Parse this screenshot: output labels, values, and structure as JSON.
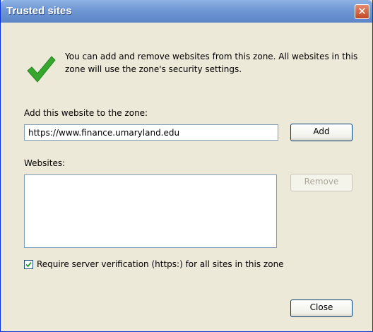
{
  "window": {
    "title": "Trusted sites",
    "close_glyph": "✕"
  },
  "info": {
    "icon": "checkmark-icon",
    "text": "You can add and remove websites from this zone. All websites in this zone will use the zone's security settings."
  },
  "add_section": {
    "label": "Add this website to the zone:",
    "url_value": "https://www.finance.umaryland.edu",
    "add_label": "Add"
  },
  "websites": {
    "label": "Websites:",
    "items": [],
    "remove_label": "Remove"
  },
  "require_https": {
    "label": "Require server verification (https:) for all sites in this zone",
    "checked": true
  },
  "footer": {
    "close_label": "Close"
  },
  "colors": {
    "titlebar": "#7BA0DA",
    "close_button": "#D9532F",
    "checkmark": "#36A62F",
    "dialog_bg": "#ECE9D8"
  }
}
